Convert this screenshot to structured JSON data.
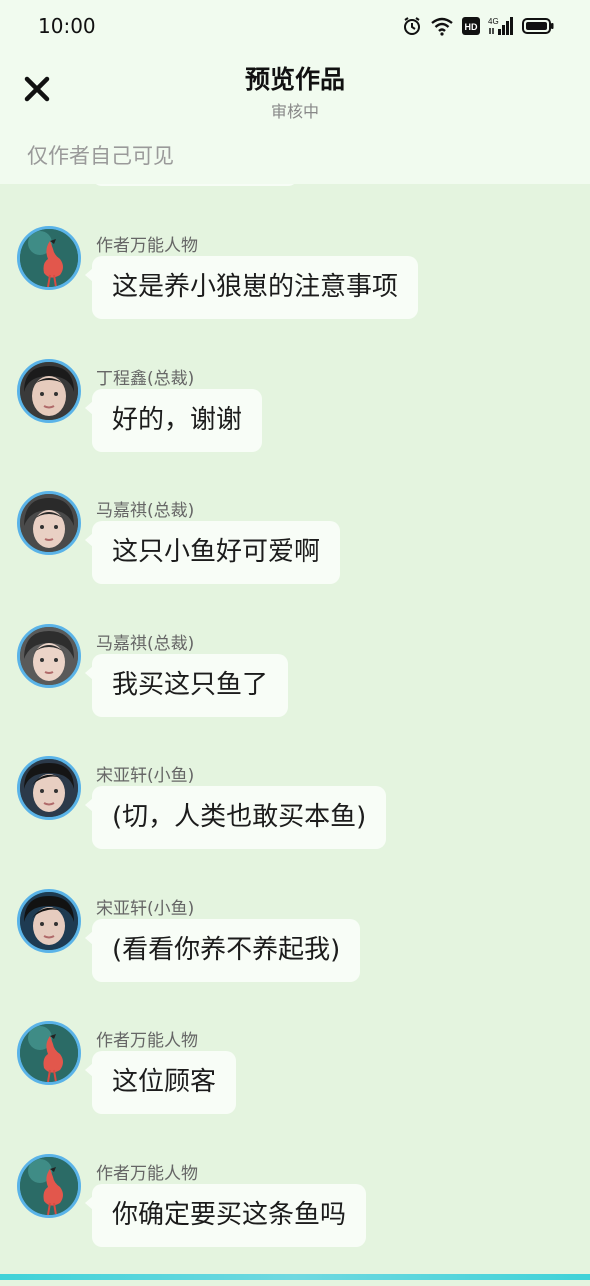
{
  "status_bar": {
    "time": "10:00",
    "network": "4G",
    "hd": "HD"
  },
  "header": {
    "title": "预览作品",
    "subtitle": "审核中",
    "visibility_note": "仅作者自己可见"
  },
  "messages": [
    {
      "sender": "作者万能人物",
      "text": "这是养小狼崽的注意事项",
      "avatar": "flamingo-avatar"
    },
    {
      "sender": "丁程鑫(总裁)",
      "text": "好的，谢谢",
      "avatar": "portrait-avatar"
    },
    {
      "sender": "马嘉祺(总裁)",
      "text": "这只小鱼好可爱啊",
      "avatar": "portrait-avatar"
    },
    {
      "sender": "马嘉祺(总裁)",
      "text": "我买这只鱼了",
      "avatar": "portrait-avatar"
    },
    {
      "sender": "宋亚轩(小鱼)",
      "text": "(切，人类也敢买本鱼)",
      "avatar": "portrait-avatar"
    },
    {
      "sender": "宋亚轩(小鱼)",
      "text": "(看看你养不养起我)",
      "avatar": "portrait-avatar"
    },
    {
      "sender": "作者万能人物",
      "text": "这位顾客",
      "avatar": "flamingo-avatar"
    },
    {
      "sender": "作者万能人物",
      "text": "你确定要买这条鱼吗",
      "avatar": "flamingo-avatar"
    }
  ],
  "colors": {
    "background": "#e4f4df",
    "header": "#f1fbef",
    "bubble": "#f8fdf7",
    "avatar_border": "#5ab3e8"
  }
}
